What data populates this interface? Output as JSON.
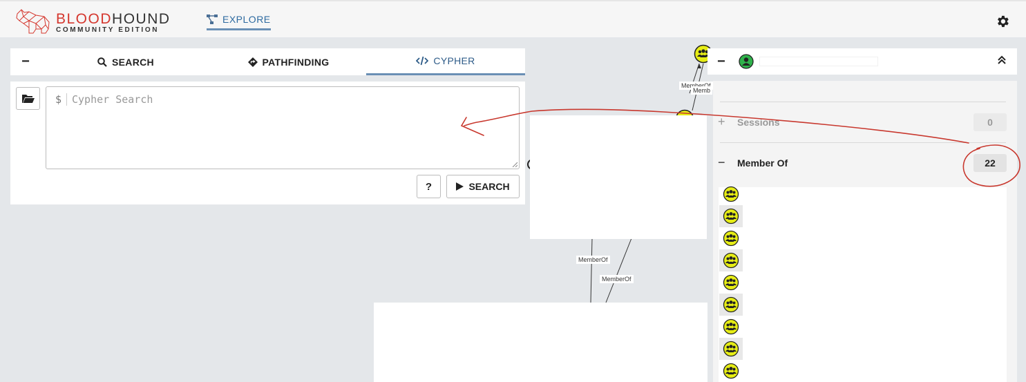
{
  "header": {
    "logo_word1": "BLOOD",
    "logo_word2": "HOUND",
    "logo_sub": "COMMUNITY EDITION",
    "nav_explore": "EXPLORE",
    "settings_icon": "gear-icon"
  },
  "search_panel": {
    "collapse_symbol": "−",
    "tabs": [
      {
        "label": "SEARCH",
        "icon": "magnifier-icon"
      },
      {
        "label": "PATHFINDING",
        "icon": "diamond-arrow-icon"
      },
      {
        "label": "CYPHER",
        "icon": "code-icon",
        "active": true
      }
    ],
    "cypher_prompt": "$",
    "cypher_placeholder": "Cypher Search",
    "help_label": "?",
    "search_button": "SEARCH"
  },
  "graph": {
    "edge_labels": [
      "MemberOf",
      "Memb",
      "MemberOf",
      "MemberOf"
    ]
  },
  "entity_panel": {
    "collapse_symbol": "−",
    "sessions": {
      "symbol": "+",
      "title": "Sessions",
      "count": "0"
    },
    "member_of": {
      "symbol": "−",
      "title": "Member Of",
      "count": "22"
    }
  },
  "colors": {
    "accent": "#2d6aa0",
    "brand_red": "#d5382f",
    "group_node": "#e6ed15",
    "user_node": "#2fb24b",
    "annotation": "#c8372d"
  }
}
